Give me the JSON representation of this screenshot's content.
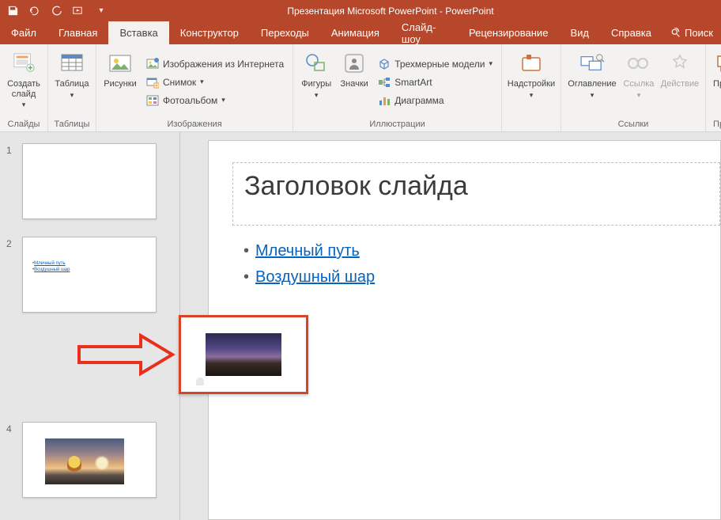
{
  "titlebar": {
    "document_title": "Презентация Microsoft PowerPoint - PowerPoint"
  },
  "tabs": {
    "file": "Файл",
    "home": "Главная",
    "insert": "Вставка",
    "design": "Конструктор",
    "transitions": "Переходы",
    "animations": "Анимация",
    "slideshow": "Слайд-шоу",
    "review": "Рецензирование",
    "view": "Вид",
    "help": "Справка",
    "search": "Поиск"
  },
  "ribbon": {
    "new_slide": "Создать слайд",
    "slides_group": "Слайды",
    "table": "Таблица",
    "tables_group": "Таблицы",
    "pictures": "Рисунки",
    "online_pictures": "Изображения из Интернета",
    "screenshot": "Снимок",
    "photo_album": "Фотоальбом",
    "images_group": "Изображения",
    "shapes": "Фигуры",
    "icons": "Значки",
    "models3d": "Трехмерные модели",
    "smartart": "SmartArt",
    "chart": "Диаграмма",
    "illustrations_group": "Иллюстрации",
    "addins": "Надстройки",
    "toc": "Оглавление",
    "link": "Ссылка",
    "action": "Действие",
    "links_group": "Ссылки",
    "comment": "Приме",
    "comments_group": "Приме"
  },
  "thumbs": {
    "n1": "1",
    "n2": "2",
    "n4": "4"
  },
  "slide": {
    "title": "Заголовок слайда",
    "link1": "Млечный путь",
    "link2": "Воздушный шар"
  }
}
